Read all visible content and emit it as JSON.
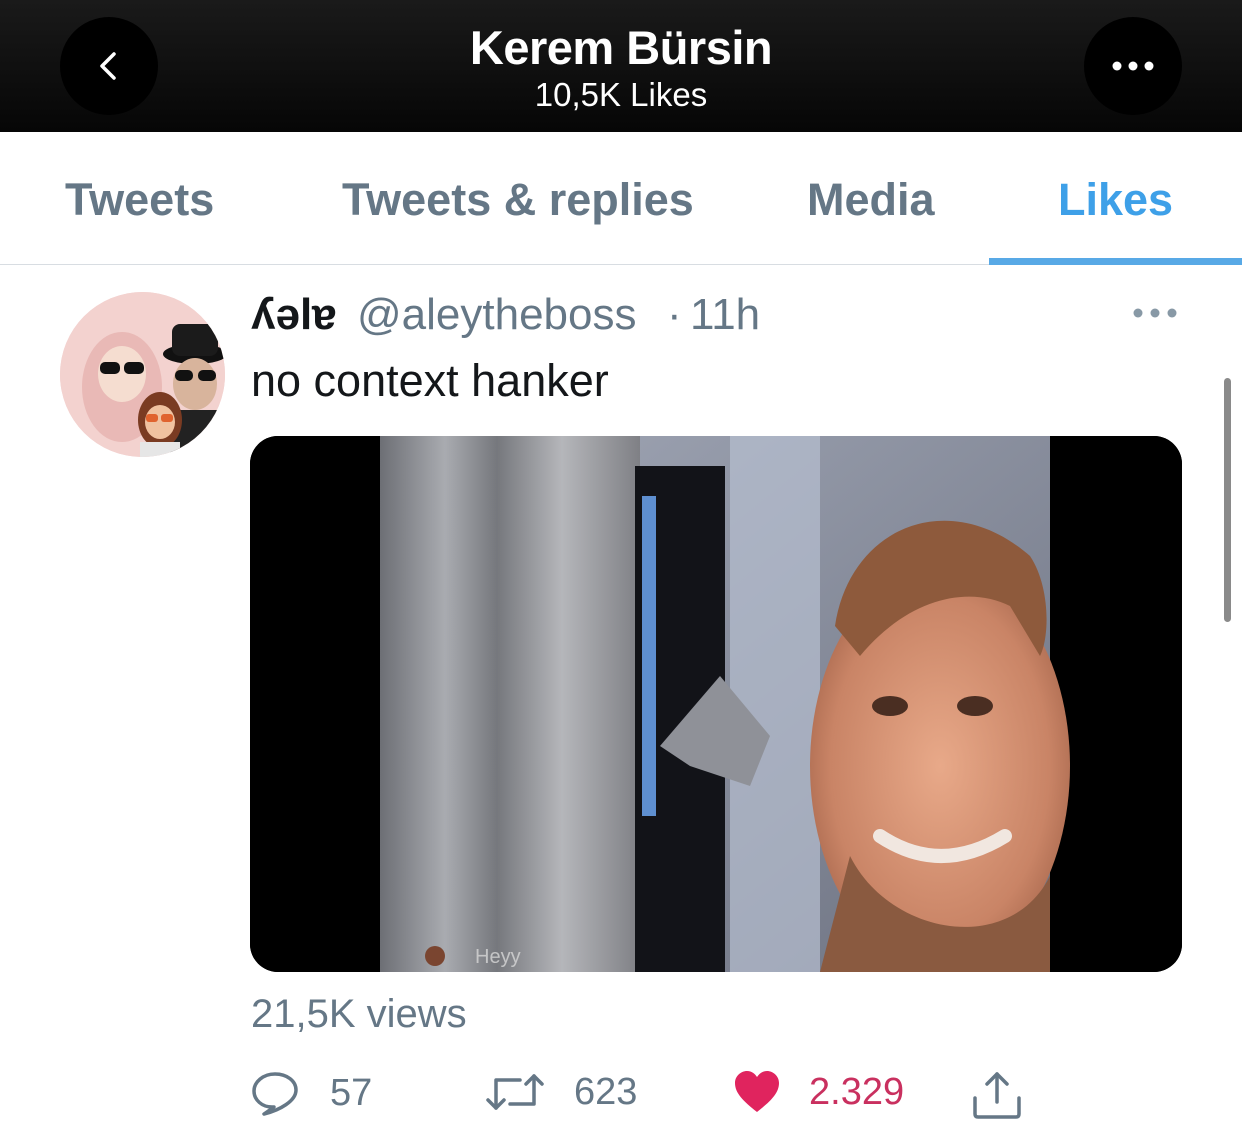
{
  "header": {
    "title": "Kerem Bürsin",
    "subtitle": "10,5K Likes"
  },
  "tabs": [
    {
      "label": "Tweets",
      "active": false
    },
    {
      "label": "Tweets & replies",
      "active": false
    },
    {
      "label": "Media",
      "active": false
    },
    {
      "label": "Likes",
      "active": true
    }
  ],
  "tweet": {
    "display_name": "ʎǝlɐ",
    "handle": "@aleytheboss",
    "separator": "·",
    "time": "11h",
    "text": "no context hanker",
    "media_overlay_text": "Heyy",
    "views": "21,5K views",
    "actions": {
      "replies": "57",
      "retweets": "623",
      "likes": "2.329"
    }
  },
  "colors": {
    "accent": "#3ea0e8",
    "like": "#e0245e",
    "muted": "#657786"
  },
  "icons": {
    "back": "chevron-left-icon",
    "more": "more-horizontal-icon",
    "reply": "reply-icon",
    "retweet": "retweet-icon",
    "like": "heart-icon",
    "share": "share-icon"
  }
}
